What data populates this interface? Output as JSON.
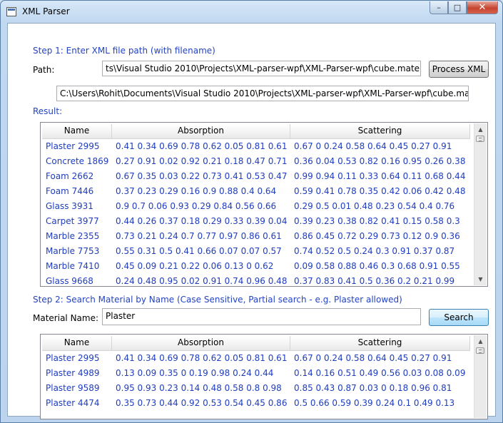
{
  "window": {
    "title": "XML Parser",
    "min_label": "–",
    "max_label": "□",
    "close_label": "✕"
  },
  "step1": {
    "label": "Step 1: Enter XML file path (with filename)",
    "path_label": "Path:",
    "path_value": "ts\\Visual Studio 2010\\Projects\\XML-parser-wpf\\XML-Parser-wpf\\cube.material.xml",
    "process_button": "Process XML",
    "full_path": "C:\\Users\\Rohit\\Documents\\Visual Studio 2010\\Projects\\XML-parser-wpf\\XML-Parser-wpf\\cube.material.xml",
    "result_label": "Result:"
  },
  "result_grid": {
    "columns": [
      "Name",
      "Absorption",
      "Scattering"
    ],
    "rows": [
      [
        "Plaster 2995",
        "0.41 0.34 0.69 0.78 0.62 0.05 0.81 0.61",
        "0.67 0 0.24 0.58 0.64 0.45 0.27 0.91"
      ],
      [
        "Concrete 1869",
        "0.27 0.91 0.02 0.92 0.21 0.18 0.47 0.71",
        "0.36 0.04 0.53 0.82 0.16 0.95 0.26 0.38"
      ],
      [
        "Foam 2662",
        "0.67 0.35 0.03 0.22 0.73 0.41 0.53 0.47",
        "0.99 0.94 0.11 0.33 0.64 0.11 0.68 0.44"
      ],
      [
        "Foam 7446",
        "0.37 0.23 0.29 0.16 0.9 0.88 0.4 0.64",
        "0.59 0.41 0.78 0.35 0.42 0.06 0.42 0.48"
      ],
      [
        "Glass 3931",
        "0.9 0.7 0.06 0.93 0.29 0.84 0.56 0.66",
        "0.29 0.5 0.01 0.48 0.23 0.54 0.4 0.76"
      ],
      [
        "Carpet 3977",
        "0.44 0.26 0.37 0.18 0.29 0.33 0.39 0.04",
        "0.39 0.23 0.38 0.82 0.41 0.15 0.58 0.3"
      ],
      [
        "Marble 2355",
        "0.73 0.21 0.24 0.7 0.77 0.97 0.86 0.61",
        "0.86 0.45 0.72 0.29 0.73 0.12 0.9 0.36"
      ],
      [
        "Marble 7753",
        "0.55 0.31 0.5 0.41 0.66 0.07 0.07 0.57",
        "0.74 0.52 0.5 0.24 0.3 0.91 0.37 0.87"
      ],
      [
        "Marble 7410",
        "0.45 0.09 0.21 0.22 0.06 0.13 0 0.62",
        "0.09 0.58 0.88 0.46 0.3 0.68 0.91 0.55"
      ],
      [
        "Glass 9668",
        "0.24 0.48 0.95 0.02 0.91 0.74 0.96 0.48",
        "0.37 0.83 0.41 0.5 0.36 0.2 0.21 0.99"
      ]
    ]
  },
  "step2": {
    "label": "Step 2: Search Material by Name (Case Sensitive, Partial search - e.g. Plaster allowed)",
    "name_label": "Material Name:",
    "name_value": "Plaster",
    "search_button": "Search"
  },
  "search_grid": {
    "columns": [
      "Name",
      "Absorption",
      "Scattering"
    ],
    "rows": [
      [
        "Plaster 2995",
        "0.41 0.34 0.69 0.78 0.62 0.05 0.81 0.61",
        "0.67 0 0.24 0.58 0.64 0.45 0.27 0.91"
      ],
      [
        "Plaster 4989",
        "0.13 0.09 0.35 0 0.19 0.98 0.24 0.44",
        "0.14 0.16 0.51 0.49 0.56 0.03 0.08 0.09"
      ],
      [
        "Plaster 9589",
        "0.95 0.93 0.23 0.14 0.48 0.58 0.8 0.98",
        "0.85 0.43 0.87 0.03 0 0.18 0.96 0.81"
      ],
      [
        "Plaster 4474",
        "0.35 0.73 0.44 0.92 0.53 0.54 0.45 0.86",
        "0.5 0.66 0.59 0.39 0.24 0.1 0.49 0.13"
      ]
    ]
  }
}
